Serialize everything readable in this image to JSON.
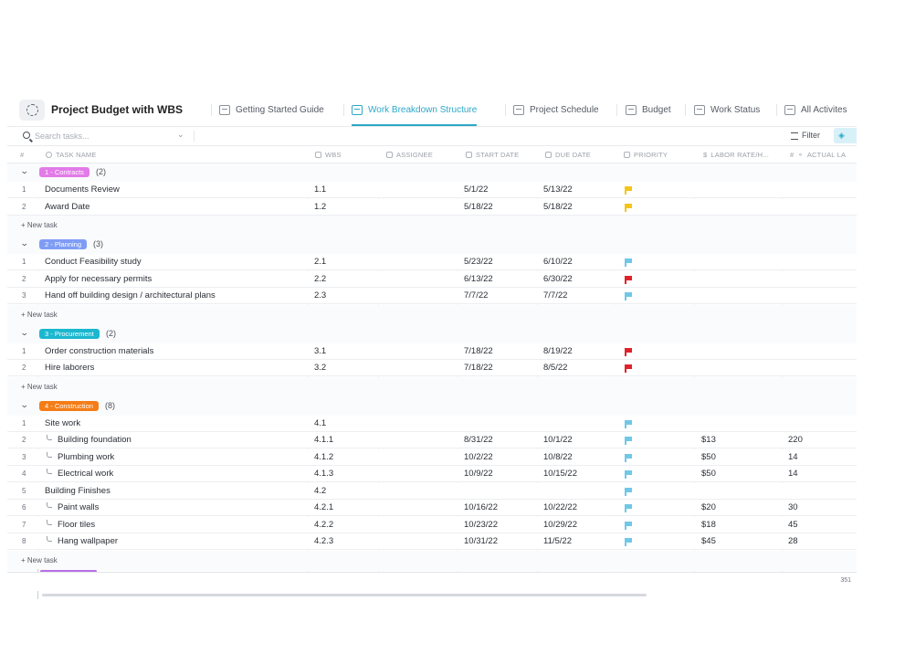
{
  "header": {
    "title": "Project Budget with WBS",
    "tabs": [
      {
        "label": "Getting Started Guide",
        "active": false,
        "icon": "doc-icon"
      },
      {
        "label": "Work Breakdown Structure",
        "active": true,
        "icon": "table-icon"
      },
      {
        "label": "Project Schedule",
        "active": false,
        "icon": "gantt-icon"
      },
      {
        "label": "Budget",
        "active": false,
        "icon": "table-icon"
      },
      {
        "label": "Work Status",
        "active": false,
        "icon": "board-icon"
      },
      {
        "label": "All Activites",
        "active": false,
        "icon": "list-icon"
      }
    ]
  },
  "toolbar": {
    "search_placeholder": "Search tasks...",
    "filter_label": "Filter"
  },
  "columns": {
    "num": "#",
    "task_name": "TASK NAME",
    "wbs": "WBS",
    "assignee": "ASSIGNEE",
    "start_date": "START DATE",
    "due_date": "DUE DATE",
    "priority": "PRIORITY",
    "labor_rate": "LABOR RATE/H...",
    "actual": "ACTUAL LA"
  },
  "colors": {
    "accent": "#2ea7c9",
    "flag_yellow": "#f5c518",
    "flag_red": "#e0222a",
    "flag_blue": "#6fc8e8"
  },
  "groups": [
    {
      "label": "1 - Contracts",
      "count": "(2)",
      "color": "#e27be8",
      "rows": [
        {
          "num": "1",
          "name": "Documents Review",
          "sub": false,
          "wbs": "1.1",
          "start": "5/1/22",
          "due": "5/13/22",
          "priority": "yellow",
          "rate": "",
          "actual": ""
        },
        {
          "num": "2",
          "name": "Award Date",
          "sub": false,
          "wbs": "1.2",
          "start": "5/18/22",
          "due": "5/18/22",
          "priority": "yellow",
          "rate": "",
          "actual": ""
        }
      ],
      "new_task": "+ New task"
    },
    {
      "label": "2 - Planning",
      "count": "(3)",
      "color": "#7f9cf5",
      "rows": [
        {
          "num": "1",
          "name": "Conduct Feasibility study",
          "sub": false,
          "wbs": "2.1",
          "start": "5/23/22",
          "due": "6/10/22",
          "priority": "blue",
          "rate": "",
          "actual": ""
        },
        {
          "num": "2",
          "name": "Apply for necessary permits",
          "sub": false,
          "wbs": "2.2",
          "start": "6/13/22",
          "due": "6/30/22",
          "priority": "red",
          "rate": "",
          "actual": ""
        },
        {
          "num": "3",
          "name": "Hand off building design / architectural plans",
          "sub": false,
          "wbs": "2.3",
          "start": "7/7/22",
          "due": "7/7/22",
          "priority": "blue",
          "rate": "",
          "actual": ""
        }
      ],
      "new_task": "+ New task"
    },
    {
      "label": "3 - Procurement",
      "count": "(2)",
      "color": "#1bb7cf",
      "rows": [
        {
          "num": "1",
          "name": "Order construction materials",
          "sub": false,
          "wbs": "3.1",
          "start": "7/18/22",
          "due": "8/19/22",
          "priority": "red",
          "rate": "",
          "actual": ""
        },
        {
          "num": "2",
          "name": "Hire laborers",
          "sub": false,
          "wbs": "3.2",
          "start": "7/18/22",
          "due": "8/5/22",
          "priority": "red",
          "rate": "",
          "actual": ""
        }
      ],
      "new_task": "+ New task"
    },
    {
      "label": "4 - Construction",
      "count": "(8)",
      "color": "#f47d17",
      "rows": [
        {
          "num": "1",
          "name": "Site work",
          "sub": false,
          "wbs": "4.1",
          "start": "",
          "due": "",
          "priority": "blue",
          "rate": "",
          "actual": ""
        },
        {
          "num": "2",
          "name": "Building foundation",
          "sub": true,
          "wbs": "4.1.1",
          "start": "8/31/22",
          "due": "10/1/22",
          "priority": "blue",
          "rate": "$13",
          "actual": "220"
        },
        {
          "num": "3",
          "name": "Plumbing work",
          "sub": true,
          "wbs": "4.1.2",
          "start": "10/2/22",
          "due": "10/8/22",
          "priority": "blue",
          "rate": "$50",
          "actual": "14"
        },
        {
          "num": "4",
          "name": "Electrical work",
          "sub": true,
          "wbs": "4.1.3",
          "start": "10/9/22",
          "due": "10/15/22",
          "priority": "blue",
          "rate": "$50",
          "actual": "14"
        },
        {
          "num": "5",
          "name": "Building Finishes",
          "sub": false,
          "wbs": "4.2",
          "start": "",
          "due": "",
          "priority": "blue",
          "rate": "",
          "actual": ""
        },
        {
          "num": "6",
          "name": "Paint walls",
          "sub": true,
          "wbs": "4.2.1",
          "start": "10/16/22",
          "due": "10/22/22",
          "priority": "blue",
          "rate": "$20",
          "actual": "30"
        },
        {
          "num": "7",
          "name": "Floor tiles",
          "sub": true,
          "wbs": "4.2.2",
          "start": "10/23/22",
          "due": "10/29/22",
          "priority": "blue",
          "rate": "$18",
          "actual": "45"
        },
        {
          "num": "8",
          "name": "Hang wallpaper",
          "sub": true,
          "wbs": "4.2.3",
          "start": "10/31/22",
          "due": "11/5/22",
          "priority": "blue",
          "rate": "$45",
          "actual": "28"
        }
      ],
      "new_task": "+ New task"
    }
  ],
  "footer": {
    "sum": "351"
  }
}
